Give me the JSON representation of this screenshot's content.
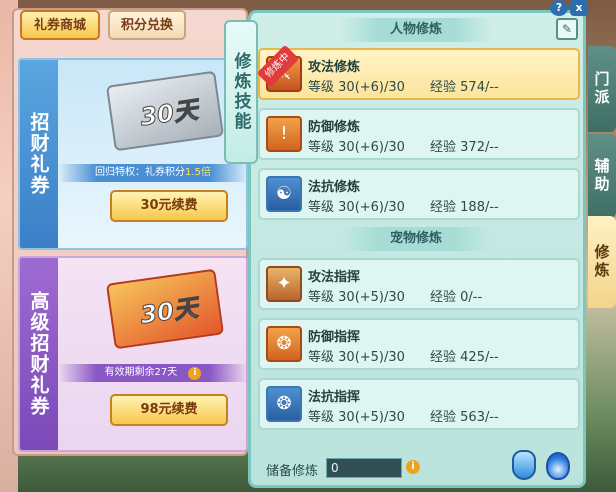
{
  "shop": {
    "tabs": [
      "礼券商城",
      "积分兑换"
    ],
    "cards": [
      {
        "title": "招财礼券",
        "ticket_text": "30天",
        "info": "回归特权：礼券积分",
        "info_highlight": "1.5倍",
        "button": "30元续费",
        "ticket_color": "silver"
      },
      {
        "title": "高级招财礼券",
        "ticket_text": "30天",
        "info": "有效期剩余27天",
        "button": "98元续费",
        "ticket_color": "gold"
      }
    ],
    "info_icon": "info-icon"
  },
  "skills_panel": {
    "vertical_label": "修炼技能",
    "section_character": "人物修炼",
    "section_pet": "宠物修炼",
    "training_badge": "修炼中",
    "character_skills": [
      {
        "name": "攻法修炼",
        "level_label": "等级",
        "level": "30(+6)/30",
        "exp_label": "经验",
        "exp": "574/--",
        "selected": true,
        "icon": "sword-shield-icon"
      },
      {
        "name": "防御修炼",
        "level_label": "等级",
        "level": "30(+6)/30",
        "exp_label": "经验",
        "exp": "372/--",
        "selected": false,
        "icon": "shield-icon"
      },
      {
        "name": "法抗修炼",
        "level_label": "等级",
        "level": "30(+6)/30",
        "exp_label": "经验",
        "exp": "188/--",
        "selected": false,
        "icon": "yin-yang-icon"
      }
    ],
    "pet_skills": [
      {
        "name": "攻法指挥",
        "level_label": "等级",
        "level": "30(+5)/30",
        "exp_label": "经验",
        "exp": "0/--",
        "icon": "paw-attack-icon"
      },
      {
        "name": "防御指挥",
        "level_label": "等级",
        "level": "30(+5)/30",
        "exp_label": "经验",
        "exp": "425/--",
        "icon": "paw-shield-icon"
      },
      {
        "name": "法抗指挥",
        "level_label": "等级",
        "level": "30(+5)/30",
        "exp_label": "经验",
        "exp": "563/--",
        "icon": "paw-magic-icon"
      }
    ],
    "reserve_label": "储备修炼",
    "reserve_value": "0"
  },
  "side_tabs": [
    "门派",
    "辅助",
    "修炼"
  ],
  "controls": {
    "help": "?",
    "close": "x"
  }
}
